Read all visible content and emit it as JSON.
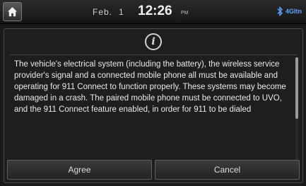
{
  "statusbar": {
    "home_icon": "home-icon",
    "date_month": "Feb.",
    "date_day": "1",
    "time": "12:26",
    "ampm": "PM",
    "bluetooth_icon": "bluetooth-icon",
    "signal_text": "4Gltn"
  },
  "dialog": {
    "icon": "info-icon",
    "icon_glyph": "i",
    "message": "The vehicle's electrical system (including the battery), the wireless service provider's signal and a connected mobile phone all must be available and operating for 911 Connect to function properly. These systems may become damaged in a crash. The paired mobile phone must be connected to UVO, and the 911 Connect feature enabled, in order for 911 to be dialed",
    "scroll_position": 0.0,
    "scroll_visible_fraction": 0.6,
    "buttons": {
      "agree": "Agree",
      "cancel": "Cancel"
    }
  },
  "colors": {
    "background": "#1a1a1a",
    "accent_blue": "#5aa7ff"
  }
}
